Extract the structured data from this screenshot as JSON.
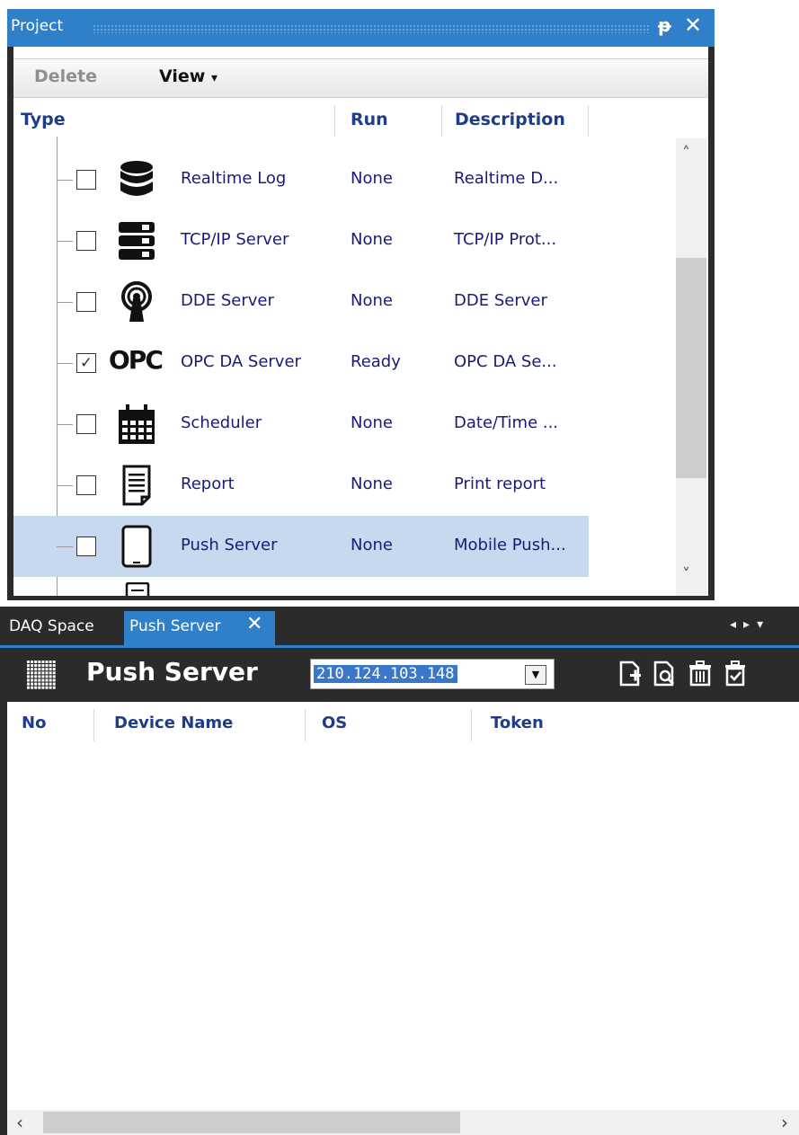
{
  "project": {
    "title": "Project",
    "toolbar": {
      "delete_label": "Delete",
      "view_label": "View",
      "view_arrow": "▾"
    },
    "columns": {
      "type": "Type",
      "run": "Run",
      "description": "Description"
    },
    "rows": [
      {
        "name": "Realtime Log",
        "run": "None",
        "description": "Realtime D...",
        "checked": false,
        "icon": "database-icon"
      },
      {
        "name": "TCP/IP Server",
        "run": "None",
        "description": "TCP/IP Prot...",
        "checked": false,
        "icon": "server-rack-icon"
      },
      {
        "name": "DDE Server",
        "run": "None",
        "description": "DDE Server",
        "checked": false,
        "icon": "antenna-icon"
      },
      {
        "name": "OPC DA Server",
        "run": "Ready",
        "description": "OPC DA Se...",
        "checked": true,
        "icon": "opc-logo-icon"
      },
      {
        "name": "Scheduler",
        "run": "None",
        "description": "Date/Time ...",
        "checked": false,
        "icon": "calendar-icon"
      },
      {
        "name": "Report",
        "run": "None",
        "description": "Print report",
        "checked": false,
        "icon": "document-icon"
      },
      {
        "name": "Push Server",
        "run": "None",
        "description": "Mobile Push...",
        "checked": false,
        "icon": "tablet-icon",
        "selected": true
      }
    ],
    "opc_logo_text": "OPC"
  },
  "push": {
    "tabs": [
      {
        "label": "DAQ Space"
      },
      {
        "label": "Push Server",
        "active": true
      }
    ],
    "title": "Push Server",
    "ip": "210.124.103.148",
    "columns": {
      "no": "No",
      "device_name": "Device Name",
      "os": "OS",
      "token": "Token"
    }
  },
  "colors": {
    "accent": "#2f80c8",
    "dark_bg": "#2b2b2b",
    "header_text": "#1f3c88",
    "selected_row": "#c8d8ef"
  }
}
